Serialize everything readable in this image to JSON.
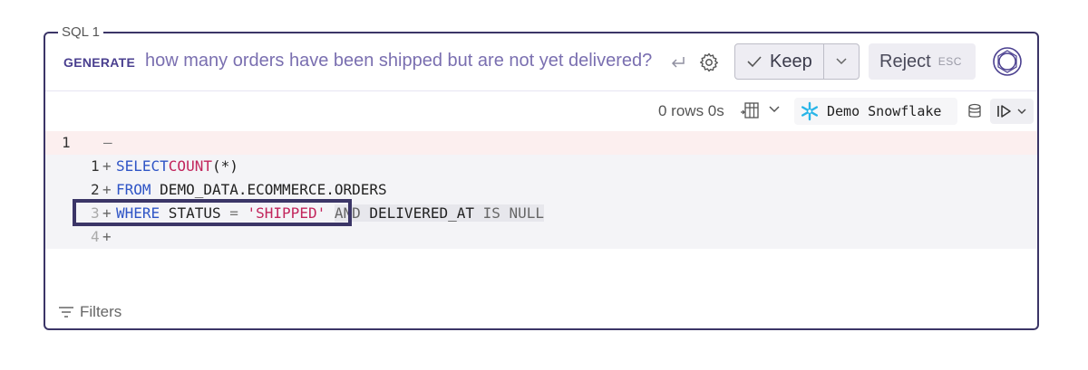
{
  "cell": {
    "label": "SQL 1"
  },
  "generate": {
    "tag": "GENERATE",
    "prompt": "how many orders have been shipped but are not yet delivered?",
    "keep_label": "Keep",
    "reject_label": "Reject",
    "esc_hint": "ESC"
  },
  "toolbar": {
    "row_stat": "0 rows 0s",
    "connection": "Demo Snowflake"
  },
  "diff": {
    "removed": {
      "old_line": "1",
      "sign": "—"
    },
    "added": [
      {
        "new_line": "1",
        "sign": "+",
        "tokens": [
          "SELECT",
          " ",
          "COUNT",
          "(*)"
        ]
      },
      {
        "new_line": "2",
        "sign": "+",
        "tokens": [
          "FROM",
          " ",
          "DEMO_DATA.ECOMMERCE.ORDERS"
        ]
      },
      {
        "new_line": "3",
        "sign": "+",
        "tokens": [
          "WHERE",
          " STATUS ",
          "=",
          " ",
          "'SHIPPED'",
          " ",
          "AND",
          " DELIVERED_AT ",
          "IS",
          " ",
          "NULL"
        ]
      },
      {
        "new_line": "4",
        "sign": "+"
      }
    ]
  },
  "footer": {
    "filters_label": "Filters"
  },
  "colors": {
    "accent": "#3b3567",
    "keyword": "#2f55c6",
    "string": "#c2255c",
    "removed_bg": "#fcefef"
  }
}
